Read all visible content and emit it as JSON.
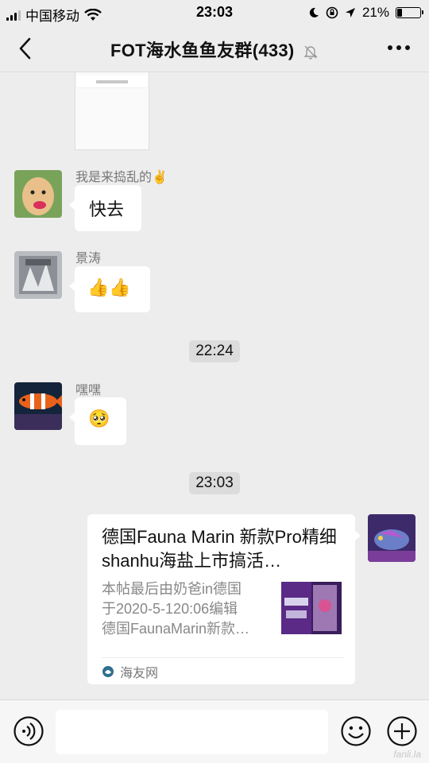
{
  "status": {
    "carrier": "中国移动",
    "time": "23:03",
    "battery": "21%",
    "battery_level": 0.21
  },
  "nav": {
    "title": "FOT海水鱼鱼友群(433)"
  },
  "messages": [
    {
      "sender": "我是来捣乱的✌️",
      "text": "快去"
    },
    {
      "sender": "景涛",
      "text": "👍👍"
    },
    {
      "sender": "嘿嘿",
      "text": "🥺"
    }
  ],
  "timestamps": [
    "22:24",
    "23:03"
  ],
  "link_card": {
    "title": "德国Fauna Marin 新款Pro精细shanhu海盐上市搞活…",
    "desc": "本帖最后由奶爸in德国\n于2020-5-120:06编辑\n德国FaunaMarin新款…",
    "source": "海友网"
  },
  "watermark": "fanli.la",
  "colors": {
    "background": "#ededed",
    "bubble": "#ffffff",
    "timestamp_bg": "#dcdcdc",
    "source_icon": "#2f6f8f"
  }
}
